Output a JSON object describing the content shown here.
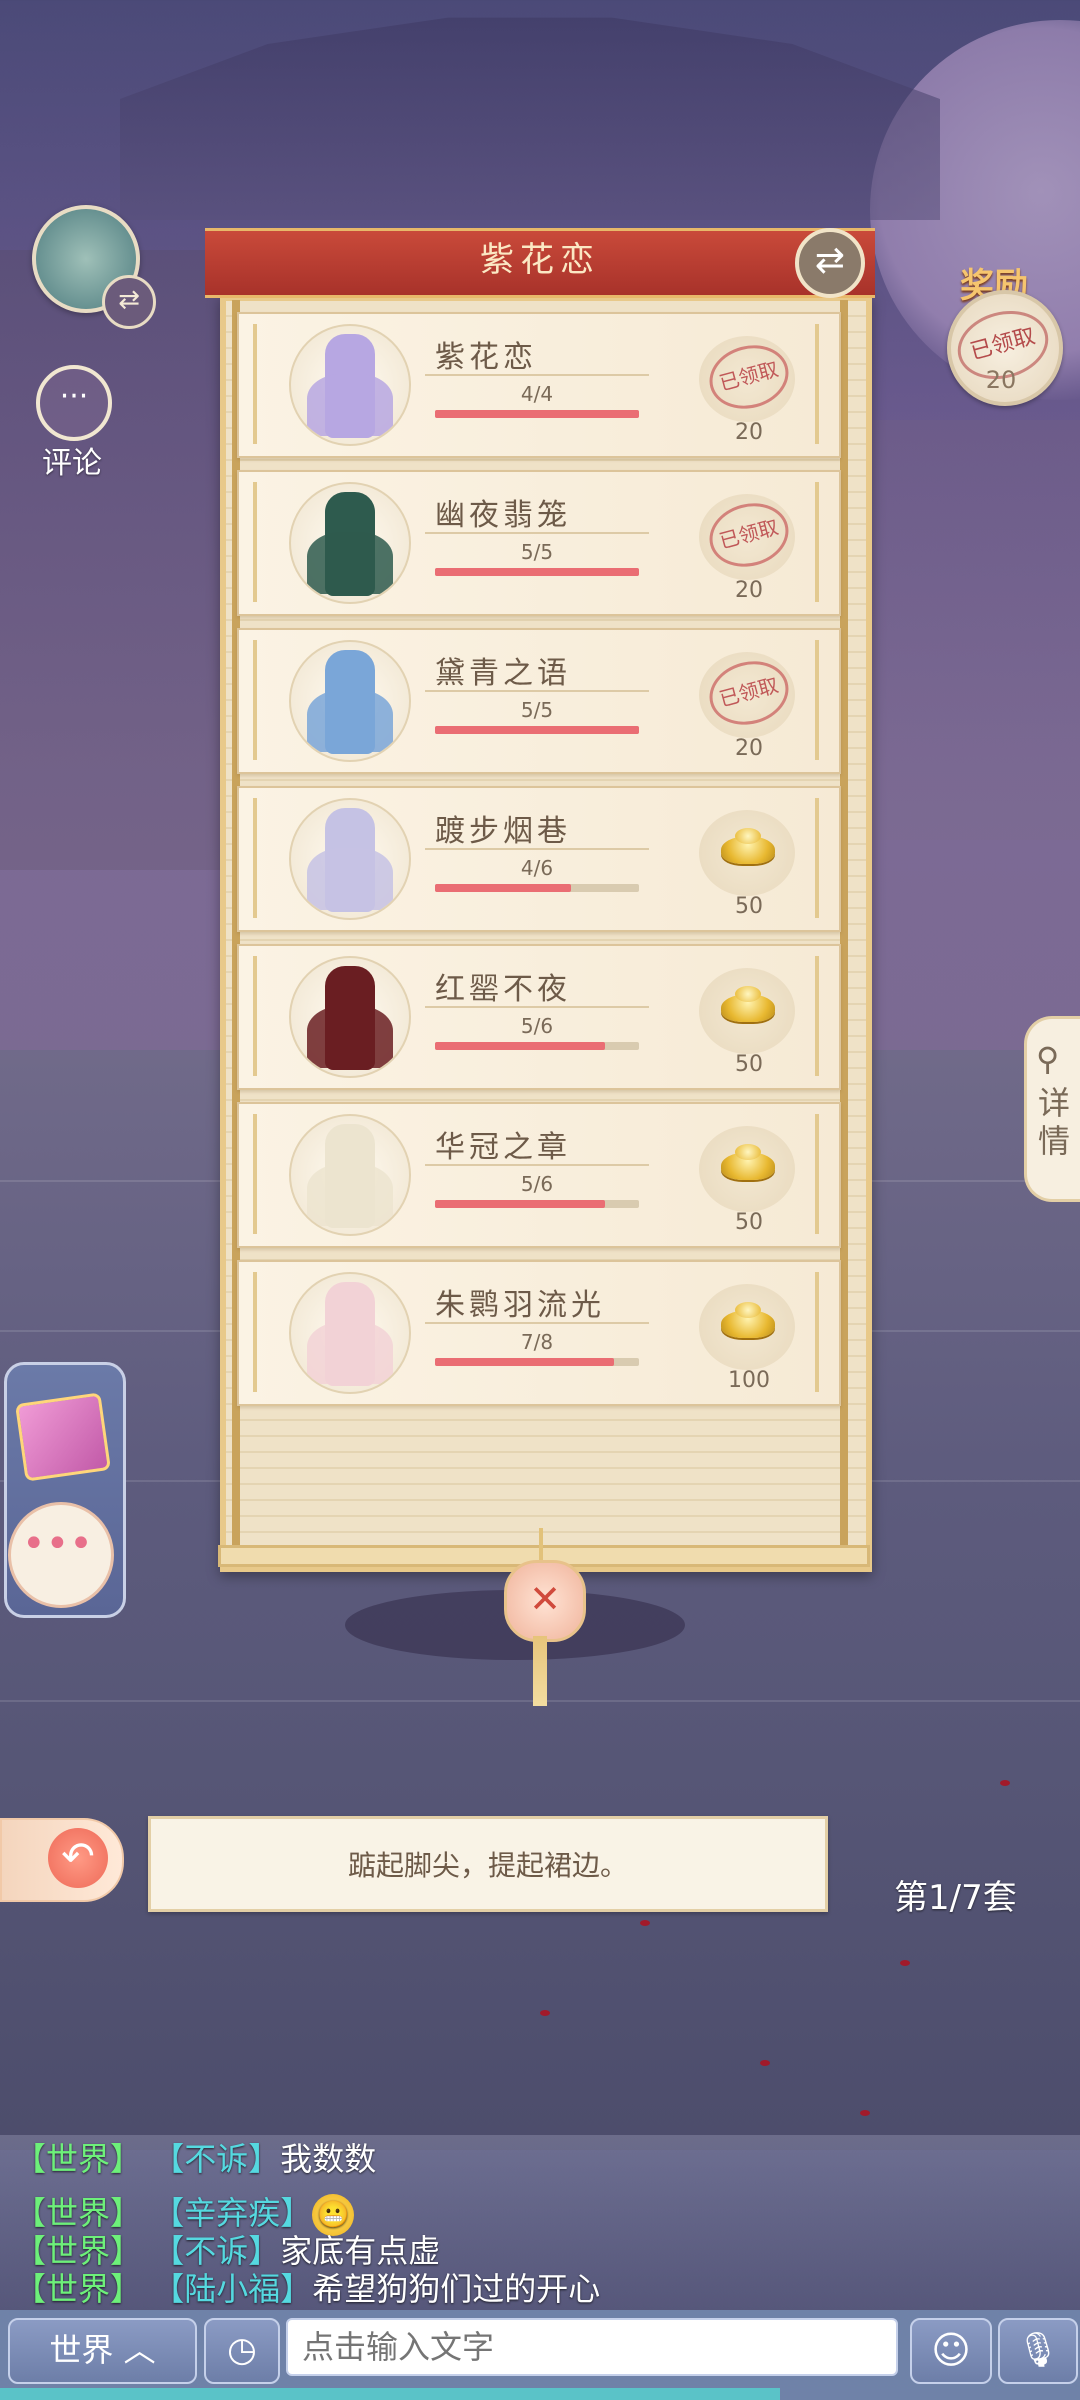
{
  "panel": {
    "title": "紫花恋",
    "sets": [
      {
        "name": "紫花恋",
        "progress": "4/4",
        "fraction": 1.0,
        "status": "claimed",
        "stamp": "已领取",
        "reward": "20",
        "dress_color": "#b7a7e2"
      },
      {
        "name": "幽夜翡笼",
        "progress": "5/5",
        "fraction": 1.0,
        "status": "claimed",
        "stamp": "已领取",
        "reward": "20",
        "dress_color": "#2e5b4e"
      },
      {
        "name": "黛青之语",
        "progress": "5/5",
        "fraction": 1.0,
        "status": "claimed",
        "stamp": "已领取",
        "reward": "20",
        "dress_color": "#7aa6d8"
      },
      {
        "name": "踱步烟巷",
        "progress": "4/6",
        "fraction": 0.6667,
        "status": "gold",
        "stamp": "",
        "reward": "50",
        "dress_color": "#c5c2e4"
      },
      {
        "name": "红罂不夜",
        "progress": "5/6",
        "fraction": 0.8333,
        "status": "gold",
        "stamp": "",
        "reward": "50",
        "dress_color": "#6a1e22"
      },
      {
        "name": "华冠之章",
        "progress": "5/6",
        "fraction": 0.8333,
        "status": "gold",
        "stamp": "",
        "reward": "50",
        "dress_color": "#ece4cf"
      },
      {
        "name": "朱鹮羽流光",
        "progress": "7/8",
        "fraction": 0.875,
        "status": "gold",
        "stamp": "",
        "reward": "100",
        "dress_color": "#f2d2d6"
      }
    ]
  },
  "top_reward": {
    "title": "奖励",
    "stamp": "已领取",
    "amount": "20"
  },
  "comment_label": "评论",
  "detail_label": "详情",
  "hint": "踮起脚尖，提起裙边。",
  "page_indicator": "第1/7套",
  "chat": [
    {
      "channel": "【世界】",
      "user": "【不诉】",
      "message": "我数数",
      "emoji": false
    },
    {
      "channel": "【世界】",
      "user": "【辛弃疾】",
      "message": "",
      "emoji": true
    },
    {
      "channel": "【世界】",
      "user": "【不诉】",
      "message": "家底有点虚",
      "emoji": false
    },
    {
      "channel": "【世界】",
      "user": "【陆小福】",
      "message": "希望狗狗们过的开心",
      "emoji": false
    }
  ],
  "bottom": {
    "channel_button": "世界 ︿",
    "input_placeholder": "点击输入文字"
  },
  "icons": {
    "swap": "swap-arrows-icon",
    "comment": "ellipsis-icon",
    "detail": "magnifier-icon",
    "close": "close-icon",
    "back": "back-arrow-icon",
    "history": "history-icon",
    "emoji": "smiley-icon",
    "mic": "microphone-icon",
    "gold": "gold-ingot-icon"
  }
}
